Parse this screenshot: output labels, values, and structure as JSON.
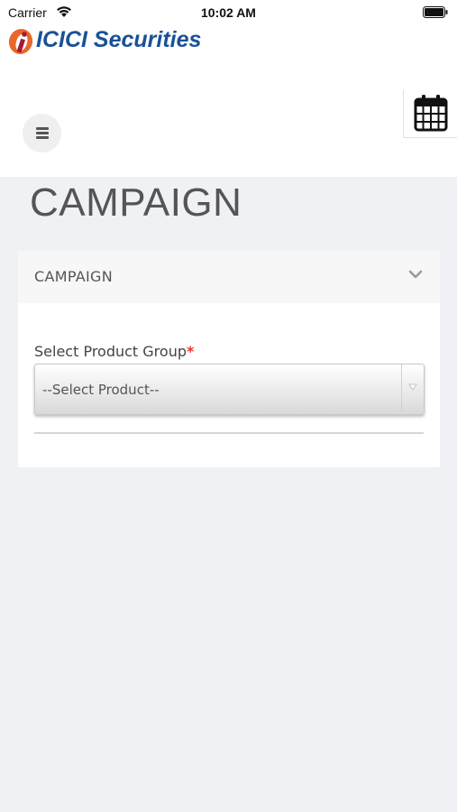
{
  "status_bar": {
    "carrier": "Carrier",
    "time": "10:02 AM"
  },
  "header": {
    "logo_text": "ICICI Securities"
  },
  "page": {
    "title": "CAMPAIGN"
  },
  "panel": {
    "title": "CAMPAIGN",
    "field_label": "Select Product Group",
    "required_mark": "*",
    "select_value": "--Select Product--"
  },
  "colors": {
    "brand_blue": "#1a5196",
    "brand_orange": "#e8672a",
    "required_red": "#e53935"
  },
  "icons": [
    "wifi-icon",
    "battery-icon",
    "icici-logo-icon",
    "hamburger-menu-icon",
    "calendar-icon",
    "chevron-down-icon",
    "dropdown-arrow-icon"
  ]
}
